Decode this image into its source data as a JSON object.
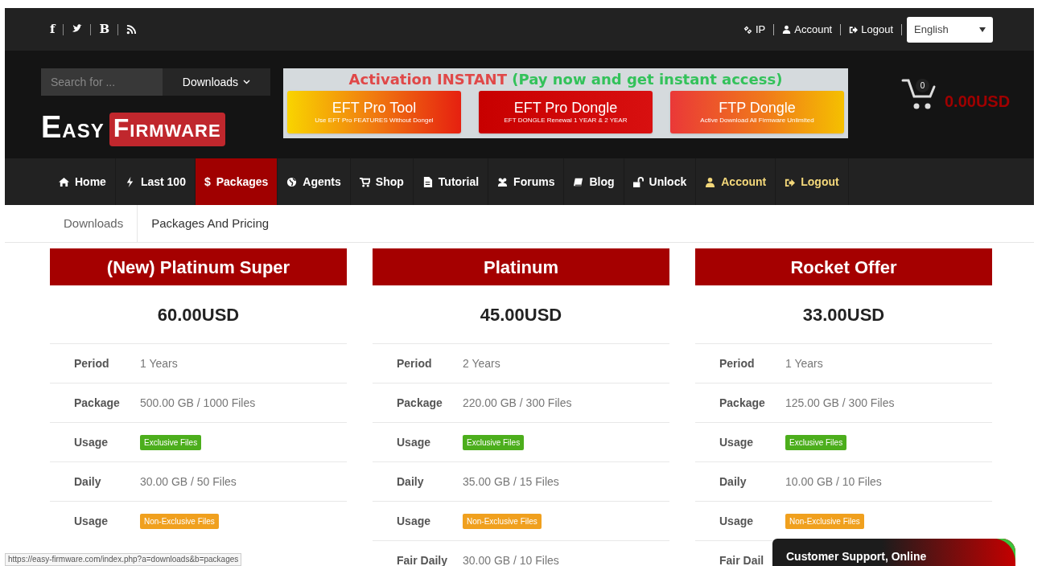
{
  "social": [
    {
      "kind": "letter",
      "text": "f"
    },
    {
      "kind": "bird"
    },
    {
      "kind": "letter",
      "text": "B"
    },
    {
      "kind": "rss"
    }
  ],
  "top_links": [
    {
      "kind": "link",
      "label": "IP"
    },
    {
      "kind": "user",
      "label": "Account"
    },
    {
      "kind": "logout",
      "label": "Logout"
    }
  ],
  "language": {
    "value": "English"
  },
  "search": {
    "placeholder": "Search for ...",
    "scope": "Downloads"
  },
  "logo": {
    "first": "EASY",
    "second": "FIRMWARE"
  },
  "banner": {
    "headline": "Activation INSTANT",
    "tagline": "(Pay now and get instant access)",
    "buttons": [
      {
        "title": "EFT Pro Tool",
        "subtitle": "Use EFT Pro FEATURES Without Dongel"
      },
      {
        "title": "EFT Pro Dongle",
        "subtitle": "EFT DONGLE Renewal 1 YEAR & 2 YEAR"
      },
      {
        "title": "FTP Dongle",
        "subtitle": "Active Download All Firmware Unlimited"
      }
    ]
  },
  "cart": {
    "count": "0",
    "total": "0.00USD"
  },
  "nav": [
    {
      "kind": "home",
      "label": "Home",
      "selected": false,
      "highlighted": false
    },
    {
      "kind": "bolt",
      "label": "Last 100",
      "selected": false,
      "highlighted": false
    },
    {
      "kind": "symbol",
      "symbol": "$",
      "label": "Packages",
      "selected": true,
      "highlighted": false
    },
    {
      "kind": "globe",
      "label": "Agents",
      "selected": false,
      "highlighted": false
    },
    {
      "kind": "cart",
      "label": "Shop",
      "selected": false,
      "highlighted": false
    },
    {
      "kind": "file",
      "label": "Tutorial",
      "selected": false,
      "highlighted": false
    },
    {
      "kind": "users",
      "label": "Forums",
      "selected": false,
      "highlighted": false
    },
    {
      "kind": "book",
      "label": "Blog",
      "selected": false,
      "highlighted": false
    },
    {
      "kind": "unlock",
      "label": "Unlock",
      "selected": false,
      "highlighted": false
    },
    {
      "kind": "user",
      "label": "Account",
      "selected": false,
      "highlighted": true
    },
    {
      "kind": "logout",
      "label": "Logout",
      "selected": false,
      "highlighted": true
    }
  ],
  "breadcrumb": [
    "Downloads",
    "Packages And Pricing"
  ],
  "packages": [
    {
      "title": "(New) Platinum Super",
      "price": "60.00USD",
      "rows": [
        {
          "kind": "text",
          "label": "Period",
          "value": "1 Years"
        },
        {
          "kind": "text",
          "label": "Package",
          "value": "500.00 GB / 1000 Files"
        },
        {
          "kind": "badge",
          "label": "Usage",
          "value": "Exclusive Files",
          "color": "#4cae1c"
        },
        {
          "kind": "text",
          "label": "Daily",
          "value": "30.00 GB / 50 Files"
        },
        {
          "kind": "badge",
          "label": "Usage",
          "value": "Non-Exclusive Files",
          "color": "#f0a01e"
        }
      ]
    },
    {
      "title": "Platinum",
      "price": "45.00USD",
      "rows": [
        {
          "kind": "text",
          "label": "Period",
          "value": "2 Years"
        },
        {
          "kind": "text",
          "label": "Package",
          "value": "220.00 GB / 300 Files"
        },
        {
          "kind": "badge",
          "label": "Usage",
          "value": "Exclusive Files",
          "color": "#4cae1c"
        },
        {
          "kind": "text",
          "label": "Daily",
          "value": "35.00 GB / 15 Files"
        },
        {
          "kind": "badge",
          "label": "Usage",
          "value": "Non-Exclusive Files",
          "color": "#f0a01e"
        },
        {
          "kind": "text",
          "label": "Fair Daily",
          "value": "30.00 GB / 10 Files"
        }
      ]
    },
    {
      "title": "Rocket Offer",
      "price": "33.00USD",
      "rows": [
        {
          "kind": "text",
          "label": "Period",
          "value": "1 Years"
        },
        {
          "kind": "text",
          "label": "Package",
          "value": "125.00 GB / 300 Files"
        },
        {
          "kind": "badge",
          "label": "Usage",
          "value": "Exclusive Files",
          "color": "#4cae1c"
        },
        {
          "kind": "text",
          "label": "Daily",
          "value": "10.00 GB / 10 Files"
        },
        {
          "kind": "badge",
          "label": "Usage",
          "value": "Non-Exclusive Files",
          "color": "#f0a01e"
        },
        {
          "kind": "label",
          "label": "Fair Dail"
        }
      ]
    }
  ],
  "status_url": "https://easy-firmware.com/index.php?a=downloads&b=packages",
  "support": {
    "text": "Customer Support, Online"
  }
}
